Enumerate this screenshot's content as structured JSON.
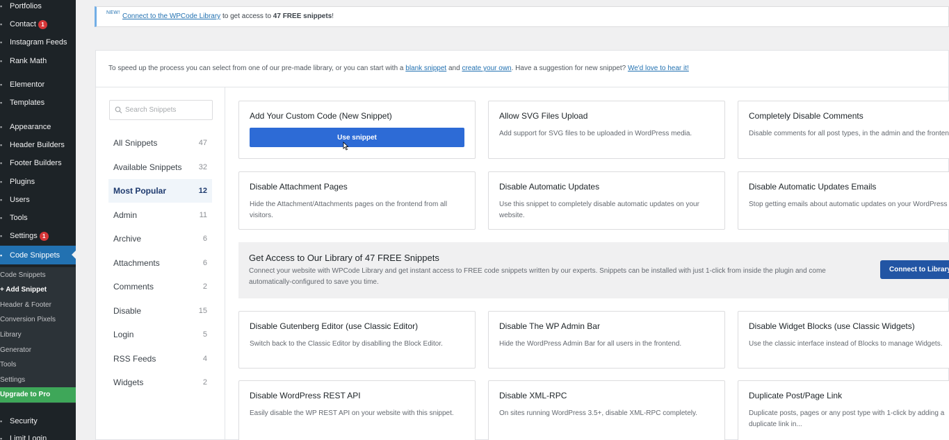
{
  "sidebar": {
    "menu": [
      {
        "label": "Portfolios",
        "icon": "portfolio-icon"
      },
      {
        "label": "Contact",
        "icon": "mail-icon",
        "badge": "1"
      },
      {
        "label": "Instagram Feeds",
        "icon": "instagram-icon"
      },
      {
        "label": "Rank Math",
        "icon": "chart-icon"
      },
      {
        "label": "Elementor",
        "icon": "elementor-icon"
      },
      {
        "label": "Templates",
        "icon": "folder-icon"
      },
      {
        "label": "Appearance",
        "icon": "brush-icon"
      },
      {
        "label": "Header Builders",
        "icon": "layout-icon"
      },
      {
        "label": "Footer Builders",
        "icon": "layout-icon"
      },
      {
        "label": "Plugins",
        "icon": "plugin-icon"
      },
      {
        "label": "Users",
        "icon": "user-icon"
      },
      {
        "label": "Tools",
        "icon": "wrench-icon"
      },
      {
        "label": "Settings",
        "icon": "settings-icon",
        "badge": "1"
      },
      {
        "label": "Code Snippets",
        "icon": "code-icon"
      }
    ],
    "submenu": [
      "Code Snippets",
      "+ Add Snippet",
      "Header & Footer",
      "Conversion Pixels",
      "Library",
      "Generator",
      "Tools",
      "Settings",
      "Upgrade to Pro"
    ],
    "after": [
      {
        "label": "Security",
        "icon": "shield-icon"
      },
      {
        "label": "Limit Login",
        "icon": "lock-icon"
      }
    ]
  },
  "notice": {
    "badge": "NEW!",
    "link": "Connect to the WPCode Library",
    "text_mid": " to get access to ",
    "text_bold": "47 FREE snippets",
    "text_end": "!"
  },
  "intro": {
    "text1": "To speed up the process you can select from one of our pre-made library, or you can start with a ",
    "link1": "blank snippet",
    "text2": " and ",
    "link2": "create your own",
    "text3": ". Have a suggestion for new snippet? ",
    "link3": "We'd love to hear it!"
  },
  "search": {
    "placeholder": "Search Snippets"
  },
  "categories": [
    {
      "label": "All Snippets",
      "count": "47"
    },
    {
      "label": "Available Snippets",
      "count": "32"
    },
    {
      "label": "Most Popular",
      "count": "12"
    },
    {
      "label": "Admin",
      "count": "11"
    },
    {
      "label": "Archive",
      "count": "6"
    },
    {
      "label": "Attachments",
      "count": "6"
    },
    {
      "label": "Comments",
      "count": "2"
    },
    {
      "label": "Disable",
      "count": "15"
    },
    {
      "label": "Login",
      "count": "5"
    },
    {
      "label": "RSS Feeds",
      "count": "4"
    },
    {
      "label": "Widgets",
      "count": "2"
    }
  ],
  "cards": [
    {
      "title": "Add Your Custom Code (New Snippet)",
      "button": "Use snippet"
    },
    {
      "title": "Allow SVG Files Upload",
      "desc": "Add support for SVG files to be uploaded in WordPress media."
    },
    {
      "title": "Completely Disable Comments",
      "desc": "Disable comments for all post types, in the admin and the frontend."
    },
    {
      "title": "Disable Attachment Pages",
      "desc": "Hide the Attachment/Attachments pages on the frontend from all visitors."
    },
    {
      "title": "Disable Automatic Updates",
      "desc": "Use this snippet to completely disable automatic updates on your website."
    },
    {
      "title": "Disable Automatic Updates Emails",
      "desc": "Stop getting emails about automatic updates on your WordPress site."
    },
    {
      "title": "Disable Gutenberg Editor (use Classic Editor)",
      "desc": "Switch back to the Classic Editor by disablling the Block Editor."
    },
    {
      "title": "Disable The WP Admin Bar",
      "desc": "Hide the WordPress Admin Bar for all users in the frontend."
    },
    {
      "title": "Disable Widget Blocks (use Classic Widgets)",
      "desc": "Use the classic interface instead of Blocks to manage Widgets."
    },
    {
      "title": "Disable WordPress REST API",
      "desc": "Easily disable the WP REST API on your website with this snippet."
    },
    {
      "title": "Disable XML-RPC",
      "desc": "On sites running WordPress 3.5+, disable XML-RPC completely."
    },
    {
      "title": "Duplicate Post/Page Link",
      "desc": "Duplicate posts, pages or any post type with 1-click by adding a duplicate link in..."
    }
  ],
  "library": {
    "title": "Get Access to Our Library of 47 FREE Snippets",
    "desc": "Connect your website with WPCode Library and get instant access to FREE code snippets written by our experts. Snippets can be installed with just 1-click from inside the plugin and come automatically-configured to save you time.",
    "button": "Connect to Library"
  },
  "colors": {
    "admin_bar": "#1d2327",
    "active_menu": "#2271b1",
    "primary_button": "#2d6bd6",
    "upgrade": "#3ea759"
  }
}
